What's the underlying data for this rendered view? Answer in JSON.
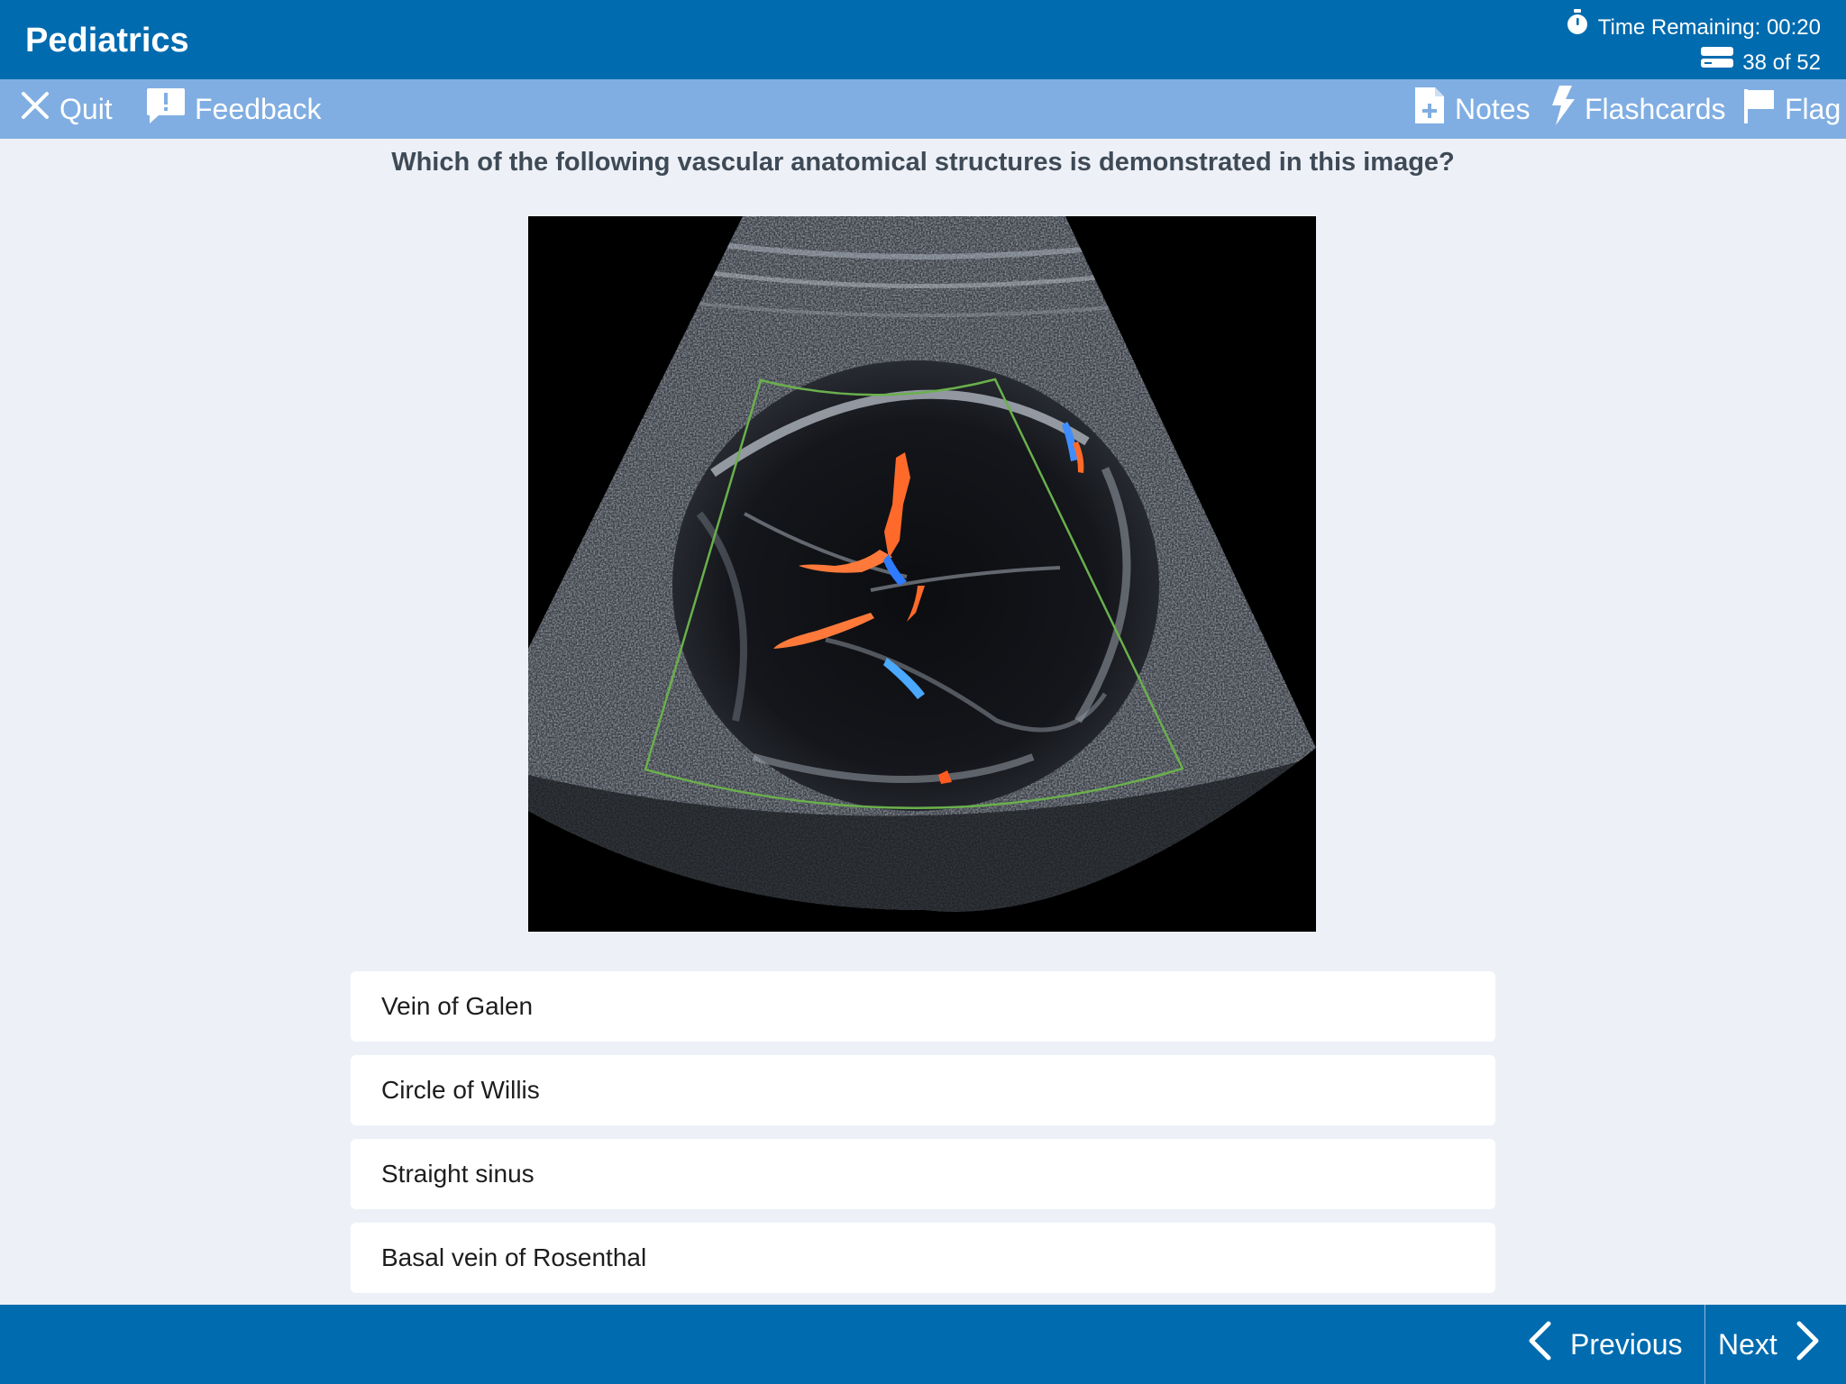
{
  "header": {
    "title": "Pediatrics",
    "time_remaining": "Time Remaining: 00:20",
    "progress": "38 of 52"
  },
  "toolbar": {
    "quit_label": "Quit",
    "feedback_label": "Feedback",
    "notes_label": "Notes",
    "flashcards_label": "Flashcards",
    "flag_label": "Flag"
  },
  "question": {
    "text": "Which of the following vascular anatomical structures is demonstrated in this image?"
  },
  "answers": [
    {
      "label": "Vein of Galen"
    },
    {
      "label": "Circle of Willis"
    },
    {
      "label": "Straight sinus"
    },
    {
      "label": "Basal vein of Rosenthal"
    }
  ],
  "footer": {
    "previous_label": "Previous",
    "next_label": "Next"
  },
  "icons": {
    "timer": "stopwatch-icon",
    "progress": "question-stack-icon",
    "quit": "close-icon",
    "feedback": "feedback-icon",
    "notes": "notes-icon",
    "flashcards": "lightning-icon",
    "flag": "flag-icon",
    "previous": "chevron-left-icon",
    "next": "chevron-right-icon"
  },
  "colors": {
    "header": "#006baf",
    "toolbar": "#80aee2",
    "background": "#edf1f7",
    "roi_box": "#6ab04c"
  }
}
